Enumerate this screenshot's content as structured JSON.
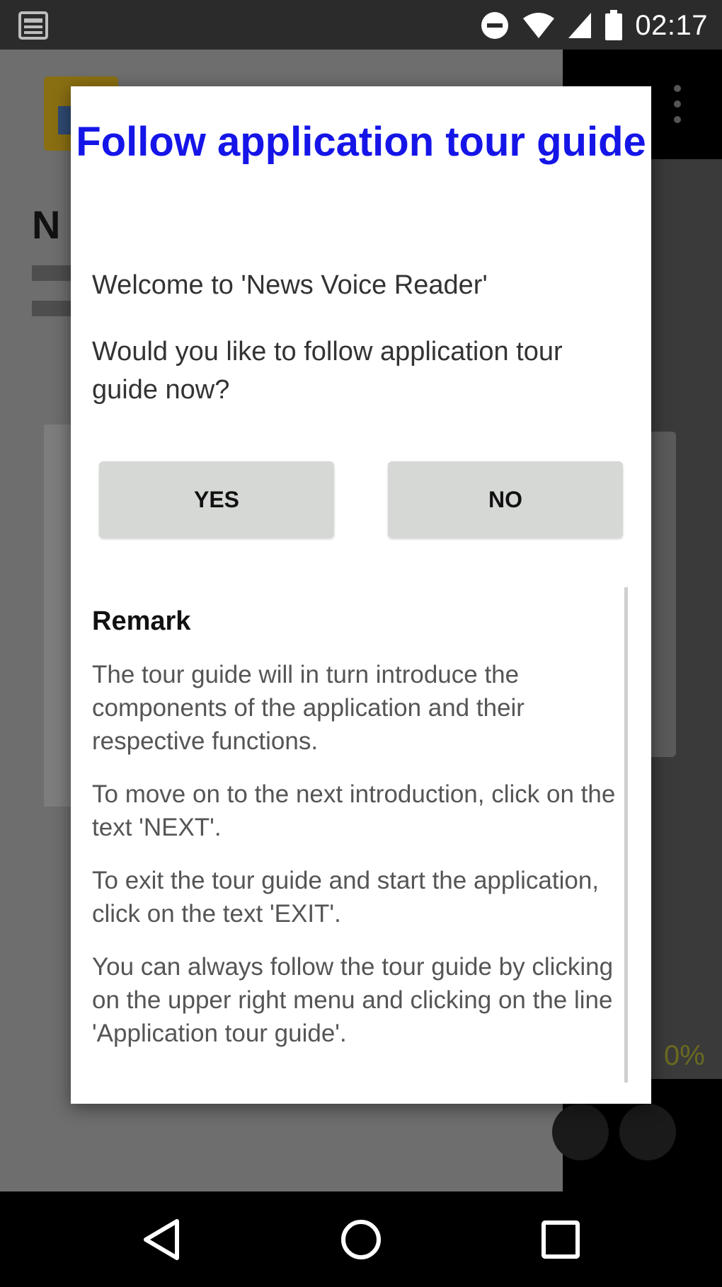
{
  "status_bar": {
    "time": "02:17",
    "icons": [
      "newspaper-notification-icon",
      "do-not-disturb-icon",
      "wifi-icon",
      "cell-signal-icon",
      "battery-icon"
    ]
  },
  "background_app": {
    "title_fragment": "N",
    "progress_text": "0%"
  },
  "dialog": {
    "title": "Follow application tour guide",
    "welcome": "Welcome to 'News Voice Reader'",
    "question": "Would you like to follow application tour guide now?",
    "yes_label": "YES",
    "no_label": "NO",
    "remark": {
      "title": "Remark",
      "paragraphs": [
        "The tour guide will in turn introduce the components of the application and their respective functions.",
        "To move on to the next introduction, click on the text 'NEXT'.",
        "To exit the tour guide and start the application, click on the text 'EXIT'.",
        "You can always follow the tour guide by clicking on the upper right menu and clicking on the line 'Application tour guide'."
      ]
    }
  },
  "nav_bar": {
    "buttons": [
      "back-icon",
      "home-icon",
      "recents-icon"
    ]
  },
  "colors": {
    "title": "#1515e8",
    "button_bg": "#d6d8d6",
    "overlay": "#6e6e6e"
  }
}
